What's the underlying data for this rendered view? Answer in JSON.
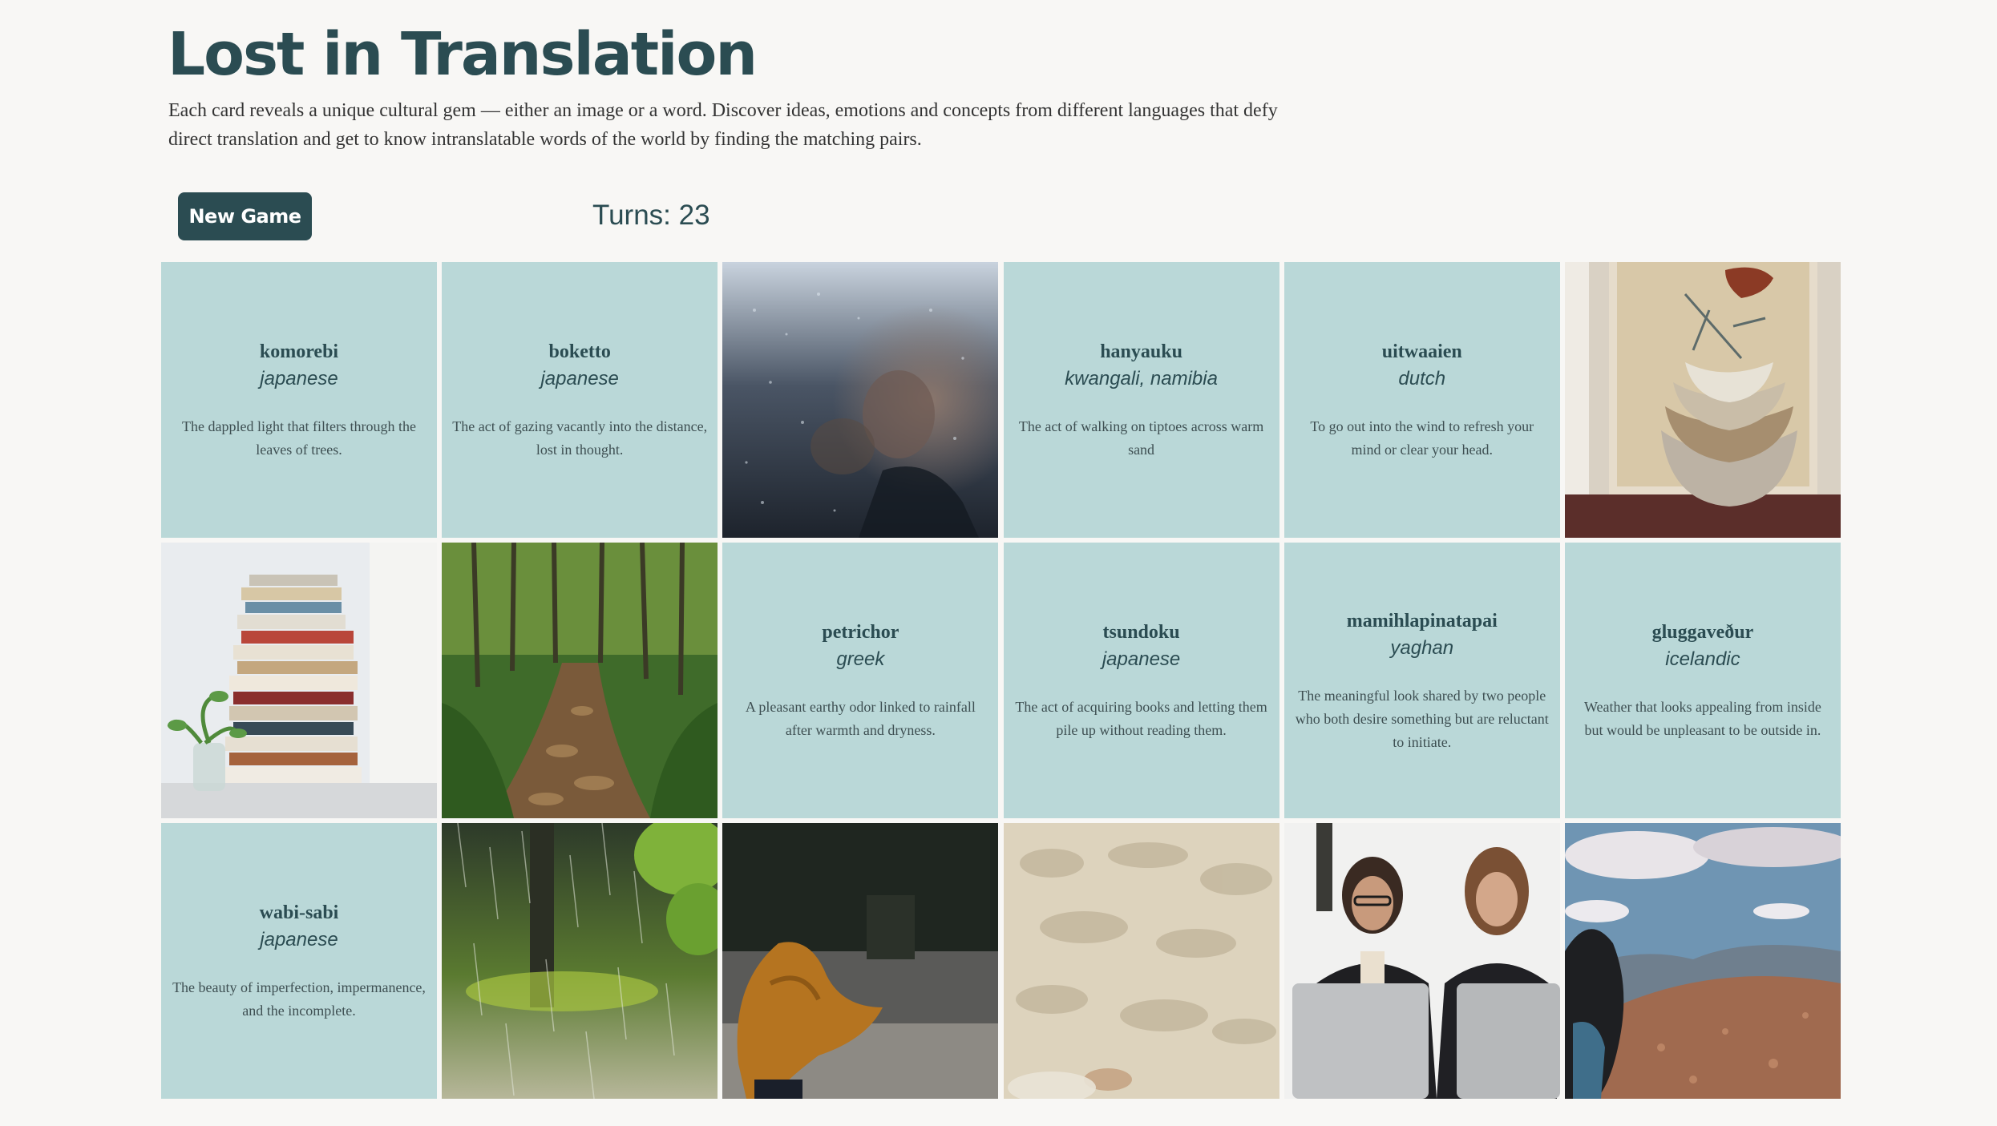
{
  "header": {
    "title": "Lost in Translation",
    "intro": "Each card reveals a unique cultural gem — either an image or a word. Discover ideas, emotions and concepts from different languages that defy direct translation and get to know intranslatable words of the world by finding the matching pairs."
  },
  "controls": {
    "new_game_label": "New Game",
    "turns_label": "Turns: ",
    "turns_value": "23"
  },
  "colors": {
    "brand": "#2b4c52",
    "card_background": "#bad8d8",
    "page_background": "#f8f7f5"
  },
  "cards": [
    {
      "type": "word",
      "word": "komorebi",
      "language": "japanese",
      "definition": "The dappled light that filters through the leaves of trees."
    },
    {
      "type": "word",
      "word": "boketto",
      "language": "japanese",
      "definition": "The act of gazing vacantly into the distance, lost in thought."
    },
    {
      "type": "image",
      "image": "person-behind-rainy-window-photo"
    },
    {
      "type": "word",
      "word": "hanyauku",
      "language": "kwangali, namibia",
      "definition": "The act of walking on tiptoes across warm sand"
    },
    {
      "type": "word",
      "word": "uitwaaien",
      "language": "dutch",
      "definition": "To go out into the wind to refresh your mind or clear your head."
    },
    {
      "type": "image",
      "image": "stacked-ceramic-bowls-photo"
    },
    {
      "type": "image",
      "image": "stack-of-books-by-window-photo"
    },
    {
      "type": "image",
      "image": "forest-path-dappled-light-photo"
    },
    {
      "type": "word",
      "word": "petrichor",
      "language": "greek",
      "definition": "A pleasant earthy odor linked to rainfall after warmth and dryness."
    },
    {
      "type": "word",
      "word": "tsundoku",
      "language": "japanese",
      "definition": "The act of acquiring books and letting them pile up without reading them."
    },
    {
      "type": "word",
      "word": "mamihlapinatapai",
      "language": "yaghan",
      "definition": "The meaningful look shared by two people who both desire something but are reluctant to initiate."
    },
    {
      "type": "word",
      "word": "gluggaveður",
      "language": "icelandic",
      "definition": "Weather that looks appealing from inside but would be unpleasant to be outside in."
    },
    {
      "type": "word",
      "word": "wabi-sabi",
      "language": "japanese",
      "definition": "The beauty of imperfection, impermanence, and the incomplete."
    },
    {
      "type": "image",
      "image": "rain-in-forest-photo"
    },
    {
      "type": "image",
      "image": "person-in-wind-blown-scarf-photo"
    },
    {
      "type": "image",
      "image": "footprint-in-sand-photo"
    },
    {
      "type": "image",
      "image": "two-women-at-laptops-photo"
    },
    {
      "type": "image",
      "image": "woman-overlooking-mountains-photo"
    }
  ]
}
